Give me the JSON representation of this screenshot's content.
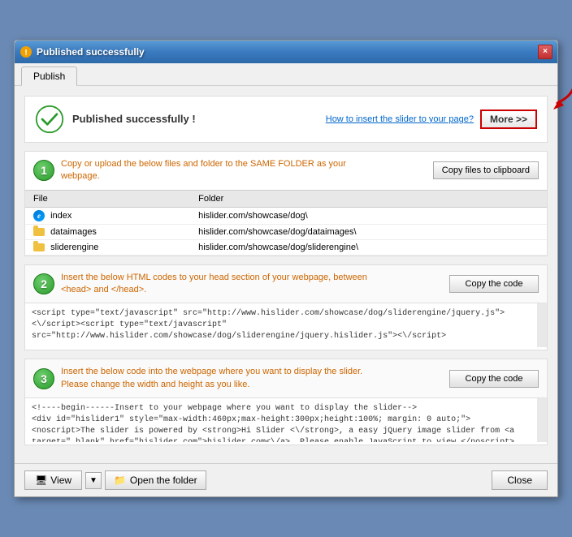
{
  "window": {
    "title": "Published successfully",
    "close_label": "×"
  },
  "tabs": [
    {
      "label": "Publish",
      "active": true
    }
  ],
  "success": {
    "title": "Published successfully !",
    "how_to_link": "How to insert the slider to your page?",
    "more_btn": "More >>"
  },
  "step1": {
    "number": "1",
    "description": "Copy or upload the below files and folder to the SAME FOLDER as your webpage.",
    "copy_btn": "Copy files to clipboard",
    "table": {
      "col1": "File",
      "col2": "Folder",
      "rows": [
        {
          "icon": "ie",
          "file": "index",
          "folder": "hislider.com/showcase/dog\\"
        },
        {
          "icon": "folder",
          "file": "dataimages",
          "folder": "hislider.com/showcase/dog/dataimages\\"
        },
        {
          "icon": "folder",
          "file": "sliderengine",
          "folder": "hislider.com/showcase/dog/sliderengine\\"
        }
      ]
    }
  },
  "step2": {
    "number": "2",
    "description": "Insert the below HTML codes to your head section of your webpage, between <head> and </head>.",
    "copy_btn": "Copy the code",
    "code": "<script type=\"text/javascript\" src=\"http://www.hislider.com/showcase/dog/sliderengine/jquery.js\"><\\/script><script type=\"text/javascript\" src=\"http://www.hislider.com/showcase/dog/sliderengine/jquery.hislider.js\"><\\/script>"
  },
  "step3": {
    "number": "3",
    "description": "Insert the below code into the webpage where you want to display the slider. Please change the width and height as you like.",
    "copy_btn": "Copy the code",
    "code": "<!----begin------Insert to your webpage where you want to display the slider-->\n<div id=\"hislider1\" style=\"max-width:460px;max-height:300px;height:100%; margin: 0 auto;\"><noscript>The slider is powered by <strong>Hi Slider <\\/strong>, a easy jQuery image slider from <a target=\"_blank\" href=\"hislider.com\">hislider.com<\\/a>. Please enable JavaScript to view.</noscript><div class=\"hi-about-text\""
  },
  "bottom": {
    "view_btn": "View",
    "open_folder_btn": "Open the folder",
    "close_btn": "Close"
  },
  "icons": {
    "view": "🖥",
    "folder": "📁",
    "copy_files_icon": "📋"
  }
}
